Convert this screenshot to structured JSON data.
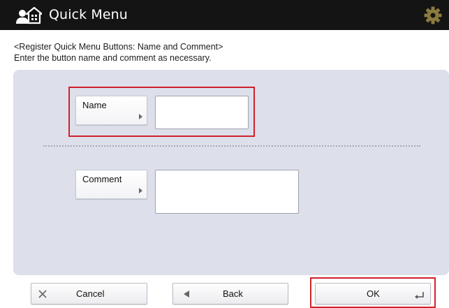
{
  "header": {
    "title": "Quick Menu",
    "app_icon": "quick-menu-user-home-icon",
    "settings_icon": "gear-icon",
    "background_color": "#141414",
    "settings_icon_color": "#8a7a3e"
  },
  "instructions": {
    "line1": "<Register Quick Menu Buttons: Name and Comment>",
    "line2": "Enter the button name and comment as necessary."
  },
  "form": {
    "panel_color": "#dde0ea",
    "name": {
      "label": "Name",
      "value": ""
    },
    "comment": {
      "label": "Comment",
      "value": ""
    },
    "highlight_color": "#d0212b"
  },
  "footer": {
    "cancel": {
      "label": "Cancel",
      "icon": "close-icon"
    },
    "back": {
      "label": "Back",
      "icon": "back-arrow-icon"
    },
    "ok": {
      "label": "OK",
      "icon": "enter-icon"
    }
  }
}
